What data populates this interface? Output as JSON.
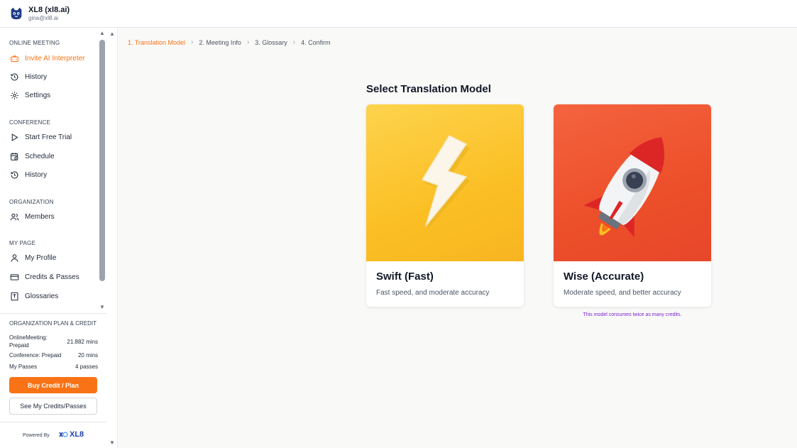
{
  "header": {
    "org_name": "XL8 (xl8.ai)",
    "email": "gina@xl8.ai"
  },
  "sidebar": {
    "sections": [
      {
        "label": "ONLINE MEETING",
        "items": [
          {
            "label": "Invite AI Interpreter",
            "icon": "briefcase-icon"
          },
          {
            "label": "History",
            "icon": "history-icon"
          },
          {
            "label": "Settings",
            "icon": "gear-icon"
          }
        ]
      },
      {
        "label": "CONFERENCE",
        "items": [
          {
            "label": "Start Free Trial",
            "icon": "play-icon"
          },
          {
            "label": "Schedule",
            "icon": "calendar-clock-icon"
          },
          {
            "label": "History",
            "icon": "history-icon"
          }
        ]
      },
      {
        "label": "ORGANIZATION",
        "items": [
          {
            "label": "Members",
            "icon": "users-icon"
          }
        ]
      },
      {
        "label": "MY PAGE",
        "items": [
          {
            "label": "My Profile",
            "icon": "user-icon"
          },
          {
            "label": "Credits & Passes",
            "icon": "credit-card-icon"
          },
          {
            "label": "Glossaries",
            "icon": "book-icon"
          }
        ]
      }
    ]
  },
  "plan": {
    "title": "ORGANIZATION PLAN & CREDIT",
    "rows": [
      {
        "label": "OnlineMeeting: Prepaid",
        "value": "21.882 mins"
      },
      {
        "label": "Conference: Prepaid",
        "value": "20 mins"
      },
      {
        "label": "My Passes",
        "value": "4 passes"
      }
    ],
    "buy_label": "Buy Credit / Plan",
    "see_label": "See My Credits/Passes"
  },
  "powered": {
    "text": "Powered By",
    "brand": "XL8"
  },
  "breadcrumb": [
    "1. Translation Model",
    "2. Meeting Info",
    "3. Glossary",
    "4. Confirm"
  ],
  "main": {
    "title": "Select Translation Model",
    "cards": [
      {
        "name": "Swift (Fast)",
        "desc": "Fast speed, and moderate accuracy",
        "icon": "lightning-icon"
      },
      {
        "name": "Wise (Accurate)",
        "desc": "Moderate speed, and better accuracy",
        "icon": "rocket-icon"
      }
    ],
    "wise_note": "This model consumes twice as many credits."
  },
  "colors": {
    "accent": "#f97316",
    "note": "#7e22ce",
    "swift_bg": "#fbbf24",
    "wise_bg": "#ec4f2a"
  }
}
